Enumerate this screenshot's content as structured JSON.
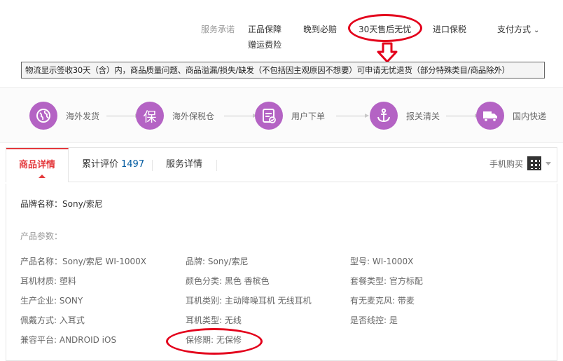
{
  "service": {
    "label": "服务承诺",
    "items": [
      "正品保障",
      "赠运费险",
      "晚到必赔",
      "30天售后无忧",
      "进口保税"
    ],
    "pay": "支付方式",
    "note": "物流显示签收30天（含）内，商品质量问题、商品溢漏/损失/缺发（不包括因主观原因不想要）可申请无忧退货（部分特殊类目/商品除外）"
  },
  "process": [
    {
      "label": "海外发货",
      "icon": "globe-icon"
    },
    {
      "label": "海外保税仓",
      "icon": "bao-icon"
    },
    {
      "label": "用户下单",
      "icon": "order-icon"
    },
    {
      "label": "报关清关",
      "icon": "anchor-icon"
    },
    {
      "label": "国内快递",
      "icon": "truck-icon"
    }
  ],
  "tabs": {
    "detail": "商品详情",
    "reviews": "累计评价",
    "reviews_count": "1497",
    "service": "服务详情",
    "mobile": "手机购买"
  },
  "details": {
    "brand": "品牌名称：Sony/索尼",
    "params_heading": "产品参数：",
    "rows": [
      [
        "产品名称：Sony/索尼 WI-1000X",
        "品牌: Sony/索尼",
        "型号: WI-1000X"
      ],
      [
        "耳机材质: 塑料",
        "颜色分类: 黑色 香槟色",
        "套餐类型: 官方标配"
      ],
      [
        "生产企业: SONY",
        "耳机类别: 主动降噪耳机 无线耳机",
        "有无麦克风: 带麦"
      ],
      [
        "佩戴方式: 入耳式",
        "耳机类型: 无线",
        "是否线控: 是"
      ],
      [
        "兼容平台: ANDROID iOS",
        "保修期: 无保修",
        ""
      ]
    ]
  },
  "colors": {
    "accent": "#e4393c",
    "purple": "#b463c4",
    "annotation": "#e3001b",
    "link": "#005aa0"
  }
}
